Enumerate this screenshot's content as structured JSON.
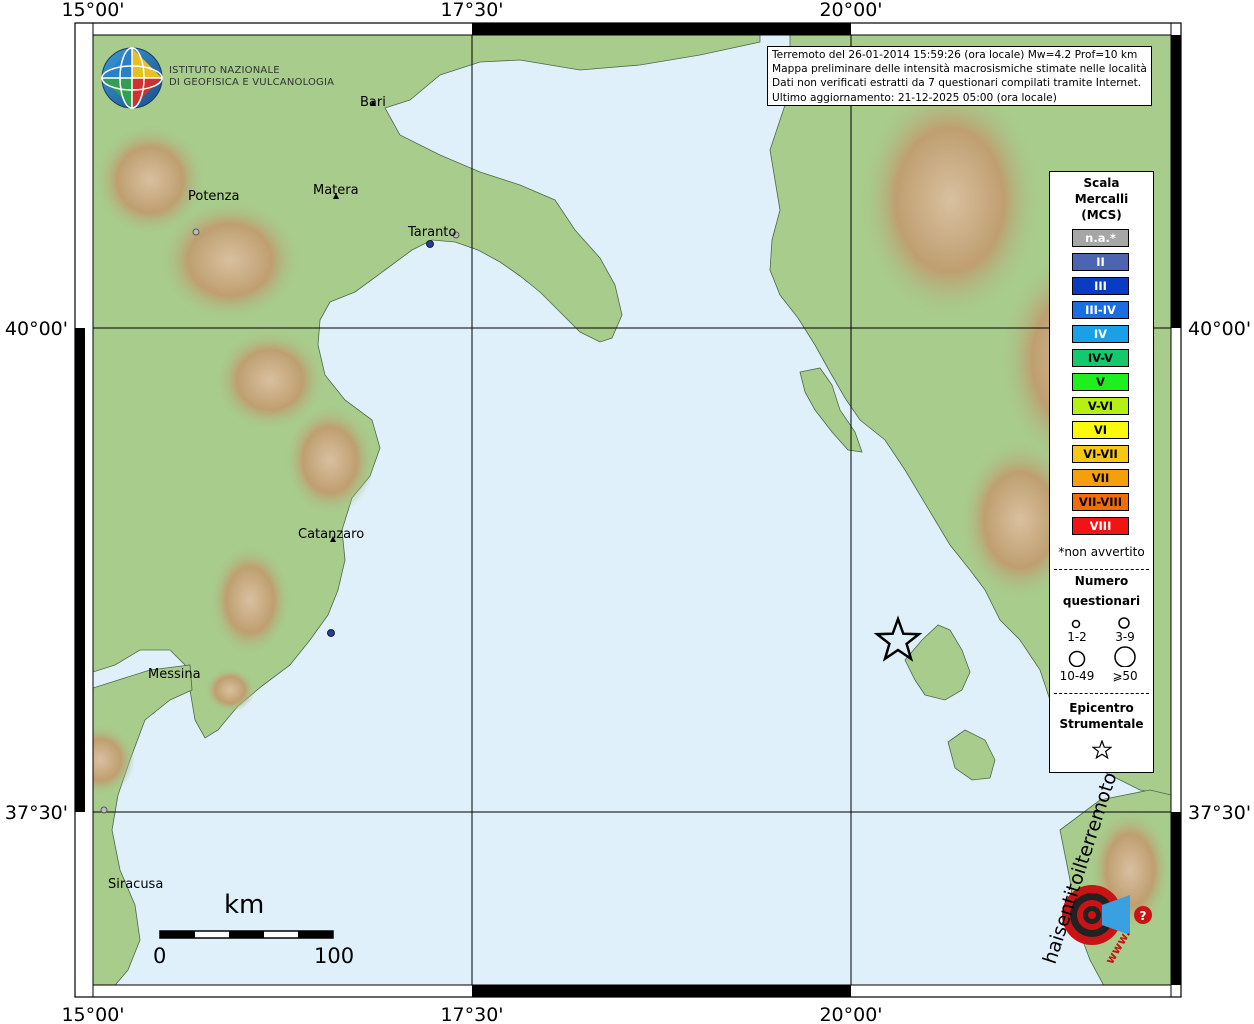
{
  "grid_labels": {
    "lon": [
      "15°00'",
      "17°30'",
      "20°00'"
    ],
    "lat": [
      "40°00'",
      "37°30'"
    ]
  },
  "institute": {
    "line1": "ISTITUTO NAZIONALE",
    "line2": "DI GEOFISICA E VULCANOLOGIA"
  },
  "info": {
    "line1": "Terremoto del 26-01-2014 15:59:26 (ora locale) Mw=4.2 Prof=10 km",
    "line2": "Mappa preliminare delle intensità macrosismiche stimate nelle località",
    "line3": "Dati non verificati estratti da 7 questionari compilati tramite Internet.",
    "line4": "Ultimo aggiornamento: 21-12-2025 05:00 (ora locale)"
  },
  "cities": {
    "bari": "Bari",
    "potenza": "Potenza",
    "matera": "Matera",
    "taranto": "Taranto",
    "catanzaro": "Catanzaro",
    "messina": "Messina",
    "siracusa": "Siracusa"
  },
  "legend": {
    "title1": "Scala",
    "title2": "Mercalli",
    "title3": "(MCS)",
    "scale": [
      {
        "label": "n.a.*",
        "color": "#a6a6a6",
        "text_color": "#ffffff"
      },
      {
        "label": "II",
        "color": "#4d64b0",
        "text_color": "#ffffff"
      },
      {
        "label": "III",
        "color": "#0a3cc3",
        "text_color": "#ffffff"
      },
      {
        "label": "III-IV",
        "color": "#1a6ee0",
        "text_color": "#ffffff"
      },
      {
        "label": "IV",
        "color": "#1aa0e6",
        "text_color": "#ffffff"
      },
      {
        "label": "IV-V",
        "color": "#14c86e",
        "text_color": "#000000"
      },
      {
        "label": "V",
        "color": "#1ef01e",
        "text_color": "#000000"
      },
      {
        "label": "V-VI",
        "color": "#b4f014",
        "text_color": "#000000"
      },
      {
        "label": "VI",
        "color": "#fafa0a",
        "text_color": "#000000"
      },
      {
        "label": "VI-VII",
        "color": "#f5c814",
        "text_color": "#000000"
      },
      {
        "label": "VII",
        "color": "#f5a00a",
        "text_color": "#000000"
      },
      {
        "label": "VII-VIII",
        "color": "#f06e0a",
        "text_color": "#000000"
      },
      {
        "label": "VIII",
        "color": "#f01414",
        "text_color": "#ffffff"
      }
    ],
    "note": "*non avvertito",
    "count_title1": "Numero",
    "count_title2": "questionari",
    "counts": [
      "1-2",
      "3-9",
      "10-49",
      "⩾50"
    ],
    "epicenter1": "Epicentro",
    "epicenter2": "Strumentale"
  },
  "scalebar": {
    "unit": "km",
    "min": "0",
    "max": "100"
  },
  "badge": {
    "text": "haisentitoilterremoto.it",
    "www": "www."
  },
  "colors": {
    "sea": "#e0f0fa",
    "land": "#a8cc8c",
    "mountain": "#c4a878",
    "border": "#000000"
  }
}
